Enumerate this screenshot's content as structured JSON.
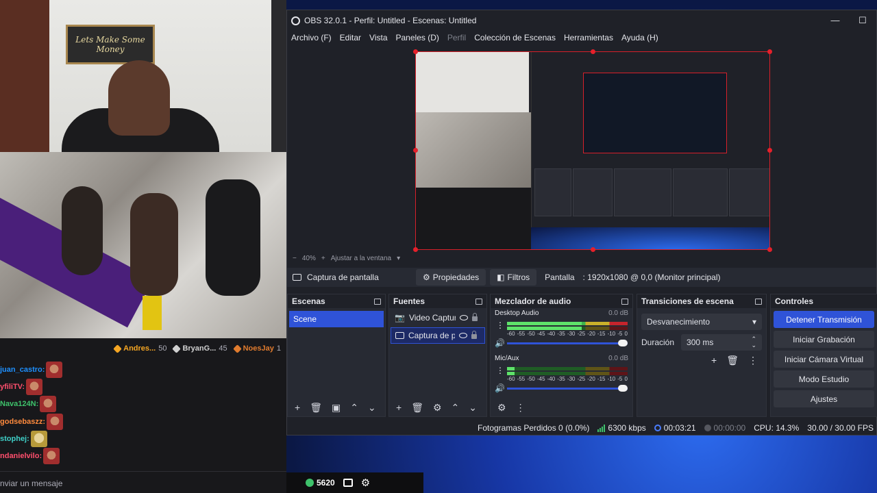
{
  "stream": {
    "poster_text": "Lets Make Some Money",
    "gifters": [
      {
        "name": "Andres...",
        "amount": "50",
        "color": "#f5a623"
      },
      {
        "name": "BryanG...",
        "amount": "45",
        "color": "#d0d0d0"
      },
      {
        "name": "NoesJay",
        "amount": "1",
        "color": "#e07b2e"
      }
    ],
    "chat": [
      {
        "user": "juan_castro:",
        "color": "#1e90ff"
      },
      {
        "user": "yfiliTV:",
        "color": "#ff4f6d"
      },
      {
        "user": "Nava124N:",
        "color": "#3ec26b"
      },
      {
        "user": "godsebaszz:",
        "color": "#ff8a3d"
      },
      {
        "user": "stophej:",
        "color": "#3fd0c8"
      },
      {
        "user": "ndanielvilo:",
        "color": "#ff4f6d"
      }
    ],
    "chat_placeholder": "nviar un mensaje",
    "points": "5620"
  },
  "obs": {
    "title": "OBS 32.0.1 - Perfil: Untitled - Escenas: Untitled",
    "window_controls": {
      "minimize": "—",
      "maximize": "☐"
    },
    "menu": [
      {
        "label": "Archivo (F)",
        "disabled": false
      },
      {
        "label": "Editar",
        "disabled": false
      },
      {
        "label": "Vista",
        "disabled": false
      },
      {
        "label": "Paneles (D)",
        "disabled": false
      },
      {
        "label": "Perfil",
        "disabled": true
      },
      {
        "label": "Colección de Escenas",
        "disabled": false
      },
      {
        "label": "Herramientas",
        "disabled": false
      },
      {
        "label": "Ayuda (H)",
        "disabled": false
      }
    ],
    "zoom": {
      "minus": "−",
      "value": "40%",
      "plus": "+",
      "fit": "Ajustar a la ventana"
    },
    "source_toolbar": {
      "source_name": "Captura de pantalla",
      "properties": "Propiedades",
      "filters": "Filtros",
      "display_label": "Pantalla",
      "display_value": ": 1920x1080 @ 0,0 (Monitor principal)"
    },
    "docks": {
      "scenes": {
        "title": "Escenas",
        "items": [
          "Scene"
        ]
      },
      "sources": {
        "title": "Fuentes",
        "items": [
          "Video Captur",
          "Captura de p"
        ]
      },
      "mixer": {
        "title": "Mezclador de audio",
        "channels": [
          {
            "name": "Desktop Audio",
            "db": "0.0 dB",
            "level": 0.62
          },
          {
            "name": "Mic/Aux",
            "db": "0.0 dB",
            "level": 0.06
          }
        ],
        "scale": [
          "-60",
          "-55",
          "-50",
          "-45",
          "-40",
          "-35",
          "-30",
          "-25",
          "-20",
          "-15",
          "-10",
          "-5",
          "0"
        ]
      },
      "transitions": {
        "title": "Transiciones de escena",
        "selected": "Desvanecimiento",
        "duration_label": "Duración",
        "duration_value": "300 ms"
      },
      "controls": {
        "title": "Controles",
        "buttons": [
          "Detener Transmisión",
          "Iniciar Grabación",
          "Iniciar Cámara Virtual",
          "Modo Estudio",
          "Ajustes"
        ]
      }
    },
    "status": {
      "dropped": "Fotogramas Perdidos 0 (0.0%)",
      "bitrate": "6300 kbps",
      "stream_time": "00:03:21",
      "rec_time": "00:00:00",
      "cpu": "CPU: 14.3%",
      "fps": "30.00 / 30.00 FPS"
    }
  }
}
